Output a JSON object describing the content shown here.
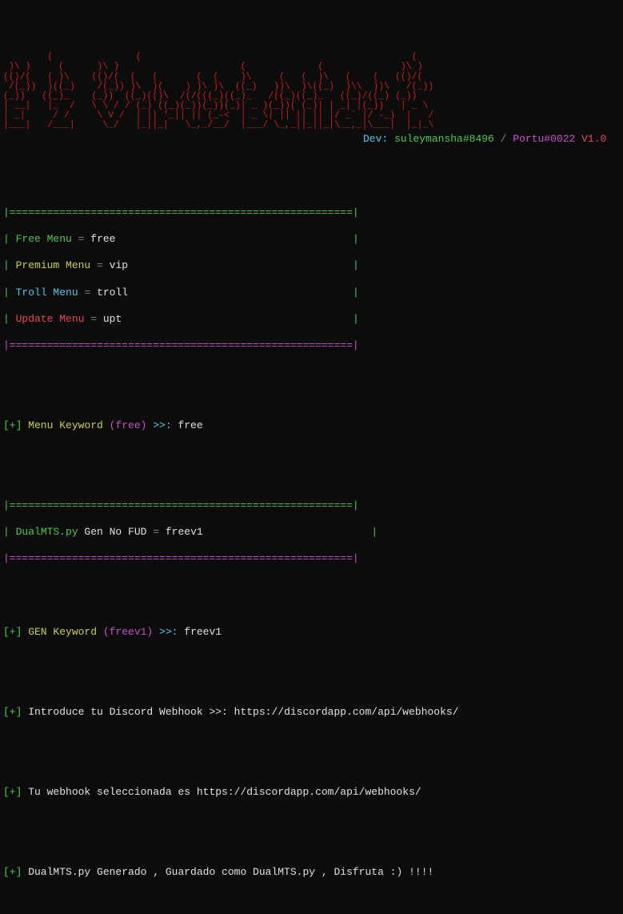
{
  "ascii_art": "        (               (                                                 (\n )\\ )     (      )\\ )                      (             (              )\\ )\n(()/(   ( )\\    (()/(  (   (       (  (    )\\     (   (  )\\   (    (   (()/(\n /(_))  )((_)    /(_)) )\\  )(    ) )\\ )\\  ((_)   ))\\  )\\((_)  )\\\\  ))\\   /(_))\n(_))   ((_)_    (_))  ((_)(()\\  /(/(((_)((_)_   /((_)((_)_   ((_)/((_) (_))\n| __|   |_  /   \\ \\ / / (_) ((_)(_))(_))(_)| _ )(_))( (_)| | _| |(_))   | _ \\\n| _|     / /     \\ V /  | || '_|| || (_-<  | _ \\| || || || |/ _` |/ -_)  |   /\n|___|   /___|     \\_/   |_||_|   \\_,_/__/  |___/ \\_,_||_||_|\\__,_|\\___|  |_|_\\",
  "dev": {
    "label": "Dev:",
    "dev1": "suleymansha#8496",
    "sep": "/",
    "dev2": "Portu#0022",
    "version": "V1.0"
  },
  "separator_green": "|=======================================================|",
  "separator_magenta": "|=======================================================|",
  "menu": {
    "free": {
      "label": "Free Menu",
      "eq": "=",
      "value": "free"
    },
    "premium": {
      "label": "Premium Menu",
      "eq": "=",
      "value": "vip"
    },
    "troll": {
      "label": "Troll Menu",
      "eq": "=",
      "value": "troll"
    },
    "update": {
      "label": "Update Menu",
      "eq": "=",
      "value": "upt"
    }
  },
  "pipe": "| ",
  "pipe_end": "|",
  "prompts": {
    "plus": "[+]",
    "menu_keyword": " Menu Keyword ",
    "menu_keyword_paren": "(free)",
    "arrow": " >>: ",
    "menu_input": "free",
    "dualmts": "DualMTS.py",
    "gen_no_fud": " Gen No FUD ",
    "eq": "= ",
    "freev1_val": "freev1",
    "gen_keyword": " GEN Keyword ",
    "gen_keyword_paren": "(freev1)",
    "gen_input": "freev1",
    "webhook_prompt": " Introduce tu Discord Webhook >>: ",
    "webhook_url": "https://discordapp.com/api/webhooks/",
    "webhook_selected": " Tu webhook seleccionada es https://discordapp.com/api/webhooks/",
    "generated": " DualMTS.py Generado , Guardado como DualMTS.py , Disfruta :) !!!!"
  }
}
